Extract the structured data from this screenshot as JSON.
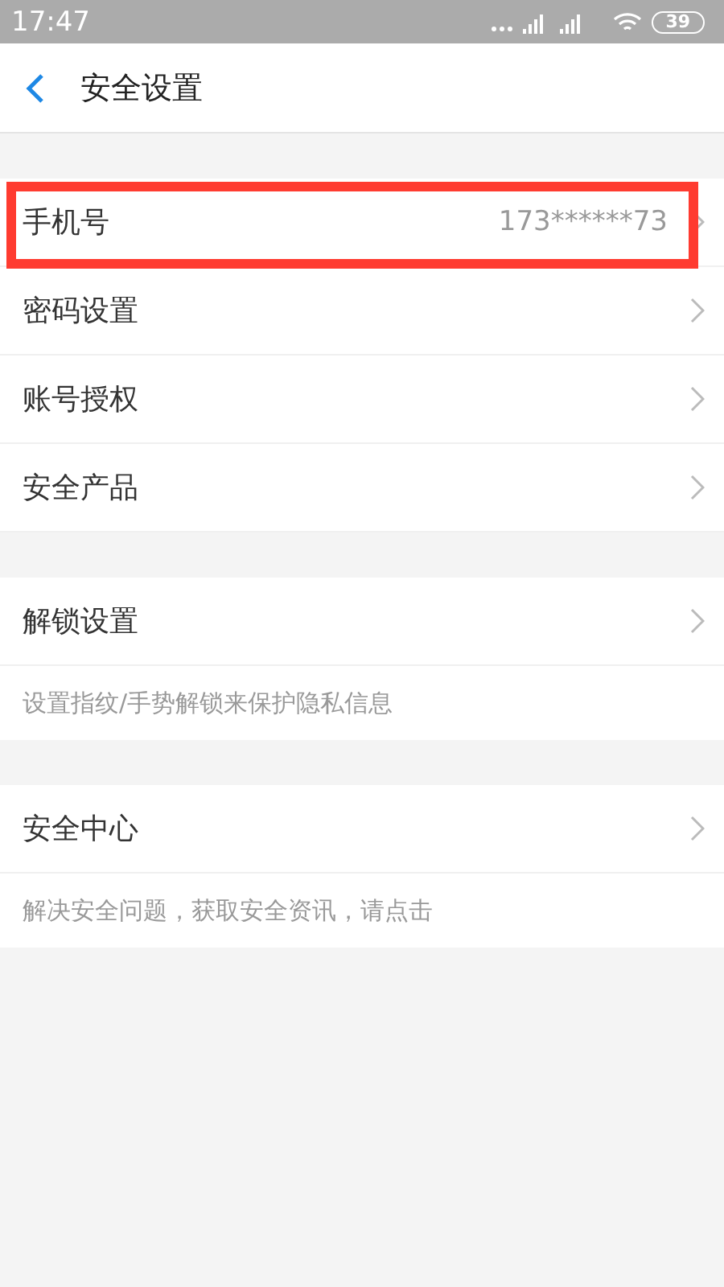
{
  "status_bar": {
    "time": "17:47",
    "battery": "39"
  },
  "header": {
    "title": "安全设置"
  },
  "sections": [
    {
      "rows": [
        {
          "label": "手机号",
          "value": "173******73",
          "highlighted": true
        },
        {
          "label": "密码设置",
          "highlighted": false
        },
        {
          "label": "账号授权",
          "highlighted": false
        },
        {
          "label": "安全产品",
          "highlighted": false
        }
      ]
    },
    {
      "rows": [
        {
          "label": "解锁设置",
          "highlighted": false
        }
      ],
      "description": "设置指纹/手势解锁来保护隐私信息"
    },
    {
      "rows": [
        {
          "label": "安全中心",
          "highlighted": false
        }
      ],
      "description": "解决安全问题，获取安全资讯，请点击"
    }
  ]
}
